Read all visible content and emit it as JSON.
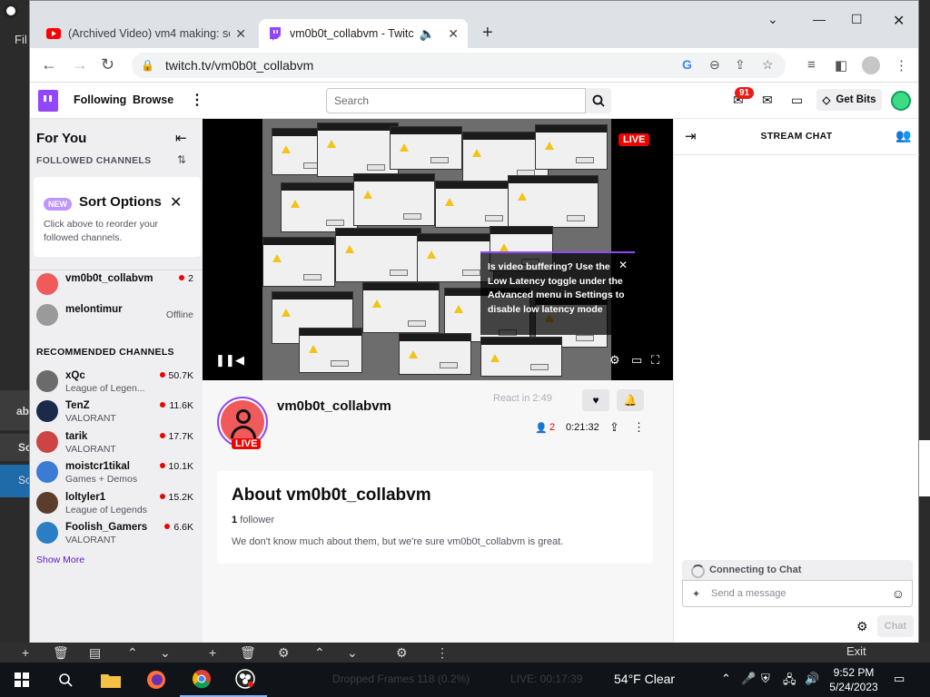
{
  "desktop": {
    "obs_menu": "Fil",
    "left_labels": [
      "ab",
      "Sc",
      "Sc"
    ]
  },
  "browser": {
    "tabs": [
      {
        "title": "(Archived Video) vm4 making: so",
        "favicon": "youtube-icon"
      },
      {
        "title": "vm0b0t_collabvm - Twitch",
        "favicon": "twitch-icon"
      }
    ],
    "url": "twitch.tv/vm0b0t_collabvm"
  },
  "twitch": {
    "nav": {
      "following": "Following",
      "browse": "Browse"
    },
    "search_placeholder": "Search",
    "notification_count": "91",
    "get_bits": "Get Bits",
    "sidebar": {
      "for_you": "For You",
      "followed_channels": "FOLLOWED CHANNELS",
      "sort_badge": "NEW",
      "sort_title": "Sort Options",
      "sort_desc": "Click above to reorder your followed channels.",
      "followed": [
        {
          "name": "vm0b0t_collabvm",
          "viewers": "2",
          "status": "live"
        },
        {
          "name": "melontimur",
          "status_text": "Offline"
        }
      ],
      "recommended_header": "RECOMMENDED CHANNELS",
      "recommended": [
        {
          "name": "xQc",
          "game": "League of Legen...",
          "viewers": "50.7K",
          "color": "#6b6b6b"
        },
        {
          "name": "TenZ",
          "game": "VALORANT",
          "viewers": "11.6K",
          "color": "#1a2b4a"
        },
        {
          "name": "tarik",
          "game": "VALORANT",
          "viewers": "17.7K",
          "color": "#c44"
        },
        {
          "name": "moistcr1tikal",
          "game": "Games + Demos",
          "viewers": "10.1K",
          "color": "#3a7bd5"
        },
        {
          "name": "loltyler1",
          "game": "League of Legends",
          "viewers": "15.2K",
          "color": "#5a3d2b"
        },
        {
          "name": "Foolish_Gamers",
          "game": "VALORANT",
          "viewers": "6.6K",
          "color": "#2b7ec4"
        }
      ],
      "show_more": "Show More"
    },
    "player": {
      "live_label": "LIVE",
      "tooltip": "Is video buffering? Use the Low Latency toggle under the Advanced menu in Settings to disable low latency mode"
    },
    "channel": {
      "name": "vm0b0t_collabvm",
      "live_badge": "LIVE",
      "react": "React in 2:49",
      "viewers": "2",
      "uptime": "0:21:32"
    },
    "about": {
      "title": "About vm0b0t_collabvm",
      "followers_count": "1",
      "followers_label": "follower",
      "description": "We don't know much about them, but we're sure vm0b0t_collabvm is great."
    },
    "chat": {
      "header": "STREAM CHAT",
      "connecting": "Connecting to Chat",
      "placeholder": "Send a message",
      "send": "Chat"
    }
  },
  "obs": {
    "exit": "Exit",
    "dropped_frames": "Dropped Frames 118 (0.2%)",
    "live_time": "LIVE: 00:17:39"
  },
  "taskbar": {
    "weather": "54°F  Clear",
    "time": "9:52 PM",
    "date": "5/24/2023"
  }
}
